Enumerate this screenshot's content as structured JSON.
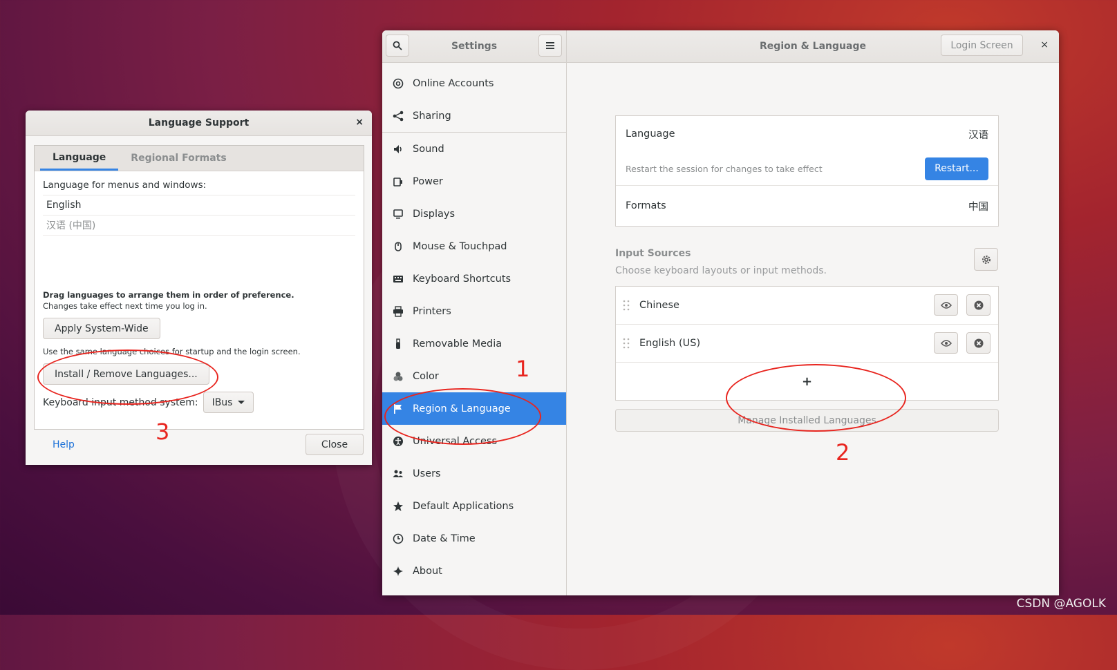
{
  "watermark": "CSDN @AGOLK",
  "language_support": {
    "title": "Language Support",
    "close_glyph": "×",
    "tabs": [
      "Language",
      "Regional Formats"
    ],
    "menus_label": "Language for menus and windows:",
    "languages": [
      "English",
      "汉语 (中国)"
    ],
    "drag_hint": "Drag languages to arrange them in order of preference.",
    "effect_hint": "Changes take effect next time you log in.",
    "apply_label": "Apply System-Wide",
    "same_hint": "Use the same language choices for startup and the login screen.",
    "install_label": "Install / Remove Languages...",
    "kbd_label": "Keyboard input method system:",
    "kbd_value": "IBus",
    "help_label": "Help",
    "close_label": "Close"
  },
  "settings": {
    "title": "Settings",
    "page_title": "Region & Language",
    "login_screen_label": "Login Screen",
    "close_glyph": "×",
    "sidebar": [
      {
        "label": "Online Accounts",
        "icon": "at-icon"
      },
      {
        "label": "Sharing",
        "icon": "share-icon"
      },
      {
        "label": "Sound",
        "icon": "speaker-icon"
      },
      {
        "label": "Power",
        "icon": "power-icon"
      },
      {
        "label": "Displays",
        "icon": "display-icon"
      },
      {
        "label": "Mouse & Touchpad",
        "icon": "mouse-icon"
      },
      {
        "label": "Keyboard Shortcuts",
        "icon": "keyboard-icon"
      },
      {
        "label": "Printers",
        "icon": "printer-icon"
      },
      {
        "label": "Removable Media",
        "icon": "usb-icon"
      },
      {
        "label": "Color",
        "icon": "color-icon"
      },
      {
        "label": "Region & Language",
        "icon": "flag-icon"
      },
      {
        "label": "Universal Access",
        "icon": "accessibility-icon"
      },
      {
        "label": "Users",
        "icon": "users-icon"
      },
      {
        "label": "Default Applications",
        "icon": "star-icon"
      },
      {
        "label": "Date & Time",
        "icon": "clock-icon"
      },
      {
        "label": "About",
        "icon": "sparkle-icon"
      }
    ],
    "selected": "Region & Language",
    "language_label": "Language",
    "language_value": "汉语",
    "restart_hint": "Restart the session for changes to take effect",
    "restart_label": "Restart...",
    "formats_label": "Formats",
    "formats_value": "中国",
    "input_sources_title": "Input Sources",
    "input_sources_sub": "Choose keyboard layouts or input methods.",
    "sources": [
      "Chinese",
      "English (US)"
    ],
    "add_glyph": "+",
    "manage_label": "Manage Installed Languages"
  },
  "annotations": {
    "one": "1",
    "two": "2",
    "three": "3"
  },
  "colors": {
    "accent": "#3584e4",
    "annotation": "#e8251f"
  }
}
